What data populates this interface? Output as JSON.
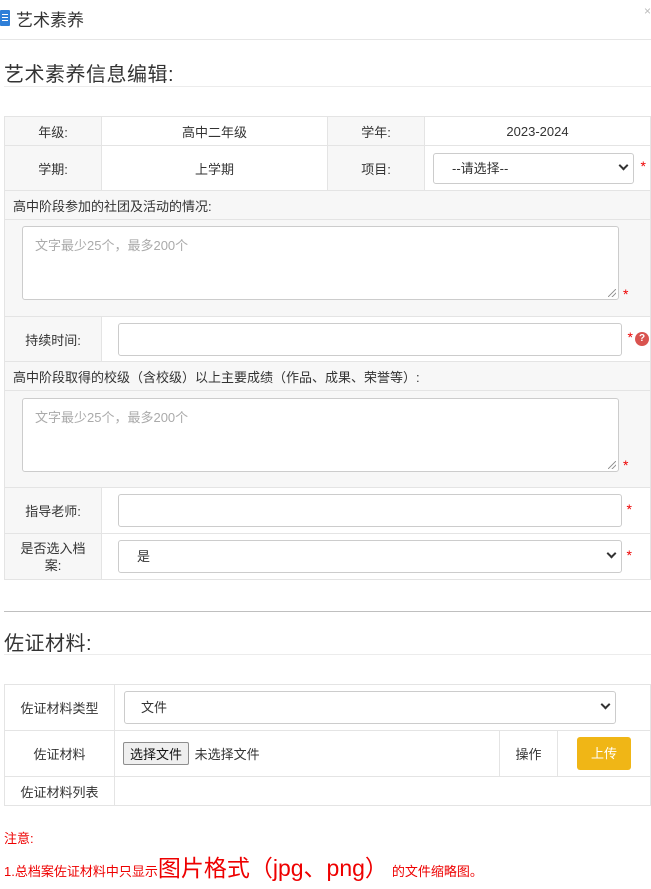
{
  "window": {
    "title": "艺术素养",
    "close": "×"
  },
  "section1": {
    "title": "艺术素养信息编辑:"
  },
  "form": {
    "grade_label": "年级:",
    "grade_value": "高中二年级",
    "year_label": "学年:",
    "year_value": "2023-2024",
    "term_label": "学期:",
    "term_value": "上学期",
    "item_label": "项目:",
    "item_select": "--请选择--",
    "clubs_label": "高中阶段参加的社团及活动的情况:",
    "clubs_placeholder": "文字最少25个，最多200个",
    "duration_label": "持续时间:",
    "duration_value": "",
    "achievements_label": "高中阶段取得的校级（含校级）以上主要成绩（作品、成果、荣誉等）:",
    "achievements_placeholder": "文字最少25个，最多200个",
    "teacher_label": "指导老师:",
    "teacher_value": "",
    "archive_label_line1": "是否选入档",
    "archive_label_line2": "案:",
    "archive_select": "是",
    "required_mark": "*",
    "help_mark": "?"
  },
  "section2": {
    "title": "佐证材料:"
  },
  "evidence": {
    "type_label": "佐证材料类型",
    "type_select": "文件",
    "file_label": "佐证材料",
    "choose_file": "选择文件",
    "no_file": "未选择文件",
    "action_label": "操作",
    "upload_button": "上传",
    "list_label": "佐证材料列表"
  },
  "notes": {
    "heading": "注意:",
    "line1_prefix": "1.总档案佐证材料中只显示",
    "line1_emphasis": "图片格式（jpg、png）",
    "line1_suffix": "的文件缩略图。"
  },
  "colors": {
    "required": "#ee0000",
    "upload_button": "#f0b616",
    "icon": "#2f7fd8"
  }
}
